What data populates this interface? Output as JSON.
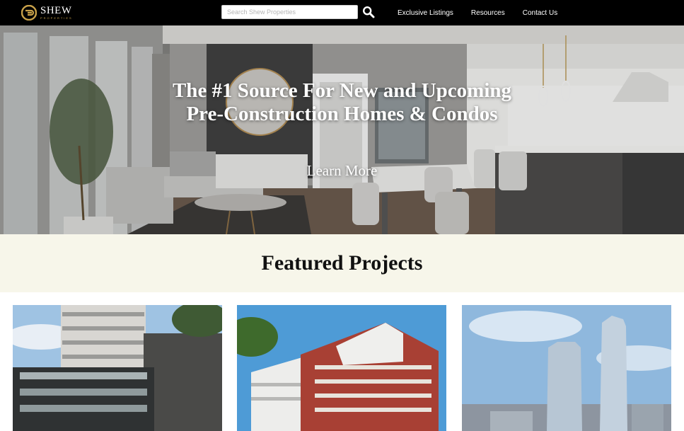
{
  "brand": {
    "name": "SHEW",
    "tagline": "PROPERTIES",
    "colors": {
      "gold": "#c9a24a",
      "nav_bg": "#000000",
      "band_bg": "#f7f6ea"
    }
  },
  "nav": {
    "search": {
      "placeholder": "Search Shew Properties",
      "value": "",
      "icon": "search-icon"
    },
    "links": [
      {
        "label": "Exclusive Listings"
      },
      {
        "label": "Resources"
      },
      {
        "label": "Contact Us"
      }
    ]
  },
  "hero": {
    "title_line1": "The #1 Source For New and Upcoming",
    "title_line2": "Pre-Construction Homes & Condos",
    "cta": "Learn More"
  },
  "featured": {
    "title": "Featured Projects"
  }
}
